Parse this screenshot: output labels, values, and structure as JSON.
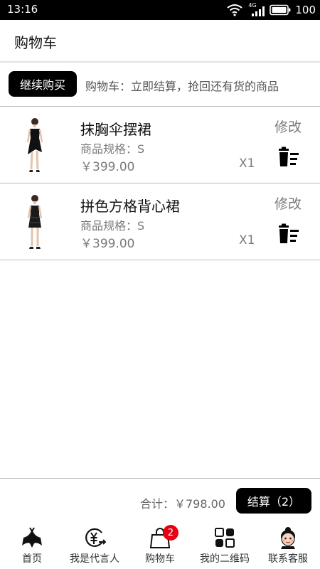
{
  "status_bar": {
    "time": "13:16",
    "network_type": "4G",
    "battery": "100",
    "icons": [
      "wifi-icon",
      "signal-icon",
      "battery-icon"
    ]
  },
  "header": {
    "title": "购物车"
  },
  "notice": {
    "continue_label": "继续购买",
    "text": "购物车：立即结算，抢回还有货的商品"
  },
  "items": [
    {
      "name": "抹胸伞摆裙",
      "spec": "商品规格：S",
      "price": "￥399.00",
      "qty": "X1",
      "edit_label": "修改",
      "thumb_icon": "dress-photo",
      "delete_icon": "trash-icon"
    },
    {
      "name": "拼色方格背心裙",
      "spec": "商品规格：S",
      "price": "￥399.00",
      "qty": "X1",
      "edit_label": "修改",
      "thumb_icon": "dress-photo",
      "delete_icon": "trash-icon"
    }
  ],
  "footer": {
    "total_label": "合计：￥798.00",
    "checkout_label": "结算（2）"
  },
  "tabs": [
    {
      "label": "首页",
      "icon": "home-logo-icon"
    },
    {
      "label": "我是代言人",
      "icon": "yen-exchange-icon"
    },
    {
      "label": "购物车",
      "icon": "shopping-bag-icon",
      "badge": "2"
    },
    {
      "label": "我的二维码",
      "icon": "qrcode-icon"
    },
    {
      "label": "联系客服",
      "icon": "support-avatar-icon"
    }
  ],
  "colors": {
    "accent": "#000000",
    "badge": "#e60012",
    "muted_text": "#7a7a7a"
  }
}
